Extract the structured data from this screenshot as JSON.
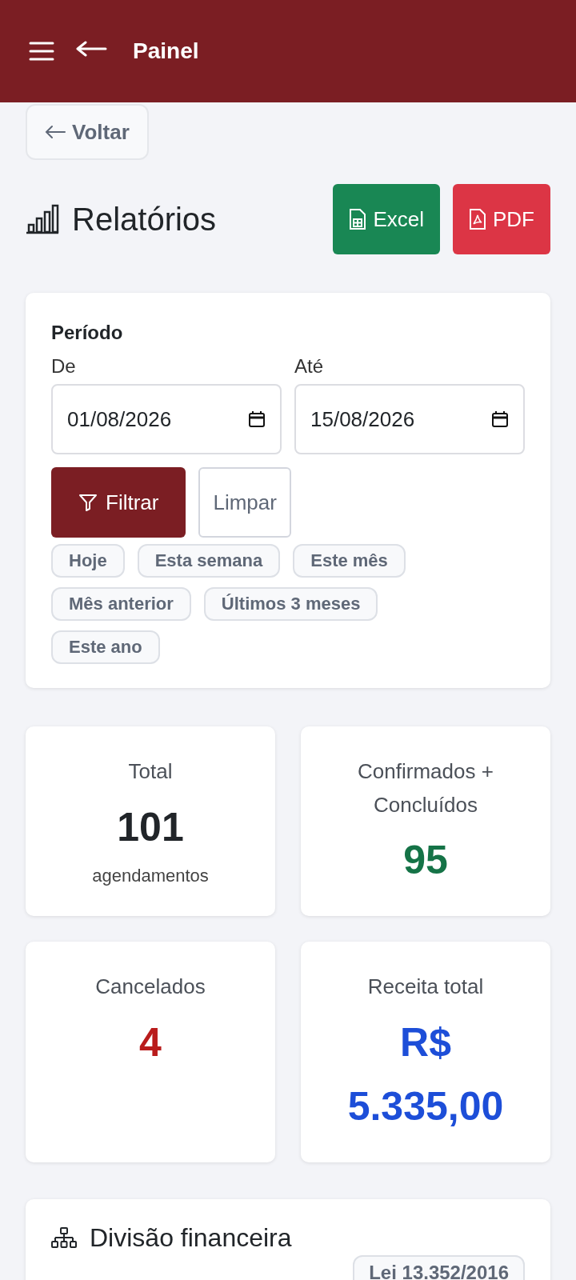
{
  "header": {
    "title": "Painel"
  },
  "back_button": {
    "label": "Voltar"
  },
  "page_title": "Relatórios",
  "export_buttons": [
    {
      "label": "Excel",
      "kind": "excel"
    },
    {
      "label": "PDF",
      "kind": "pdf"
    }
  ],
  "filter": {
    "heading": "Período",
    "from": {
      "label": "De",
      "value": "01/08/2026"
    },
    "to": {
      "label": "Até",
      "value": "15/08/2026"
    },
    "filter_button": "Filtrar",
    "clear_button": "Limpar",
    "presets": [
      "Hoje",
      "Esta semana",
      "Este mês",
      "Mês anterior",
      "Últimos 3 meses",
      "Este ano"
    ]
  },
  "stats": [
    {
      "label": "Total",
      "value": "101",
      "caption": "agendamentos",
      "color": "#212529"
    },
    {
      "label": "Confirmados + Concluídos",
      "value": "95",
      "color": "#157347"
    },
    {
      "label": "Cancelados",
      "value": "4",
      "color": "#b91c1c"
    },
    {
      "label": "Receita total",
      "value": "R$ 5.335,00",
      "color": "#1d4ed8"
    }
  ],
  "split_section": {
    "title": "Divisão financeira",
    "badge": "Lei 13.352/2016"
  }
}
